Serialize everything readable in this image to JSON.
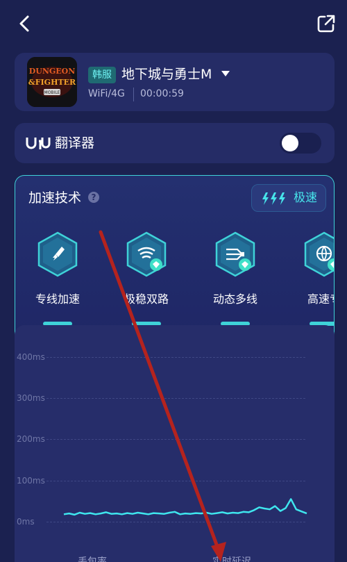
{
  "header": {
    "back_icon": "chevron-left-icon",
    "share_icon": "share-out-icon"
  },
  "game": {
    "region": "韩服",
    "title": "地下城与勇士M",
    "network": "WiFi/4G",
    "elapsed": "00:00:59",
    "logo_text": "DUNGEON FIGHTER MOBILE"
  },
  "translator": {
    "label": "翻译器",
    "enabled": false
  },
  "acceleration": {
    "title": "加速技术",
    "mode_label": "极速",
    "features": [
      {
        "label": "专线加速",
        "icon": "rocket-icon",
        "premium": false
      },
      {
        "label": "极稳双路",
        "icon": "wifi-dual-icon",
        "premium": true
      },
      {
        "label": "动态多线",
        "icon": "multi-line-icon",
        "premium": true
      },
      {
        "label": "高速专",
        "icon": "globe-icon",
        "premium": true
      }
    ]
  },
  "chart_data": {
    "type": "line",
    "yticks": [
      "400ms",
      "300ms",
      "200ms",
      "100ms",
      "0ms"
    ],
    "ylim": [
      0,
      400
    ],
    "grid": true,
    "series": [
      {
        "color": "#3fe6ee",
        "values": [
          18,
          20,
          17,
          22,
          19,
          21,
          18,
          20,
          23,
          19,
          20,
          18,
          21,
          19,
          22,
          20,
          18,
          21,
          20,
          19,
          22,
          24,
          18,
          20,
          19,
          21,
          20,
          22,
          19,
          21,
          23,
          20,
          22,
          21,
          24,
          23,
          28,
          35,
          32,
          30,
          38,
          26,
          33,
          55,
          30,
          25,
          20
        ]
      }
    ]
  },
  "bottom_tabs": [
    "丢包率",
    "实时延迟"
  ]
}
